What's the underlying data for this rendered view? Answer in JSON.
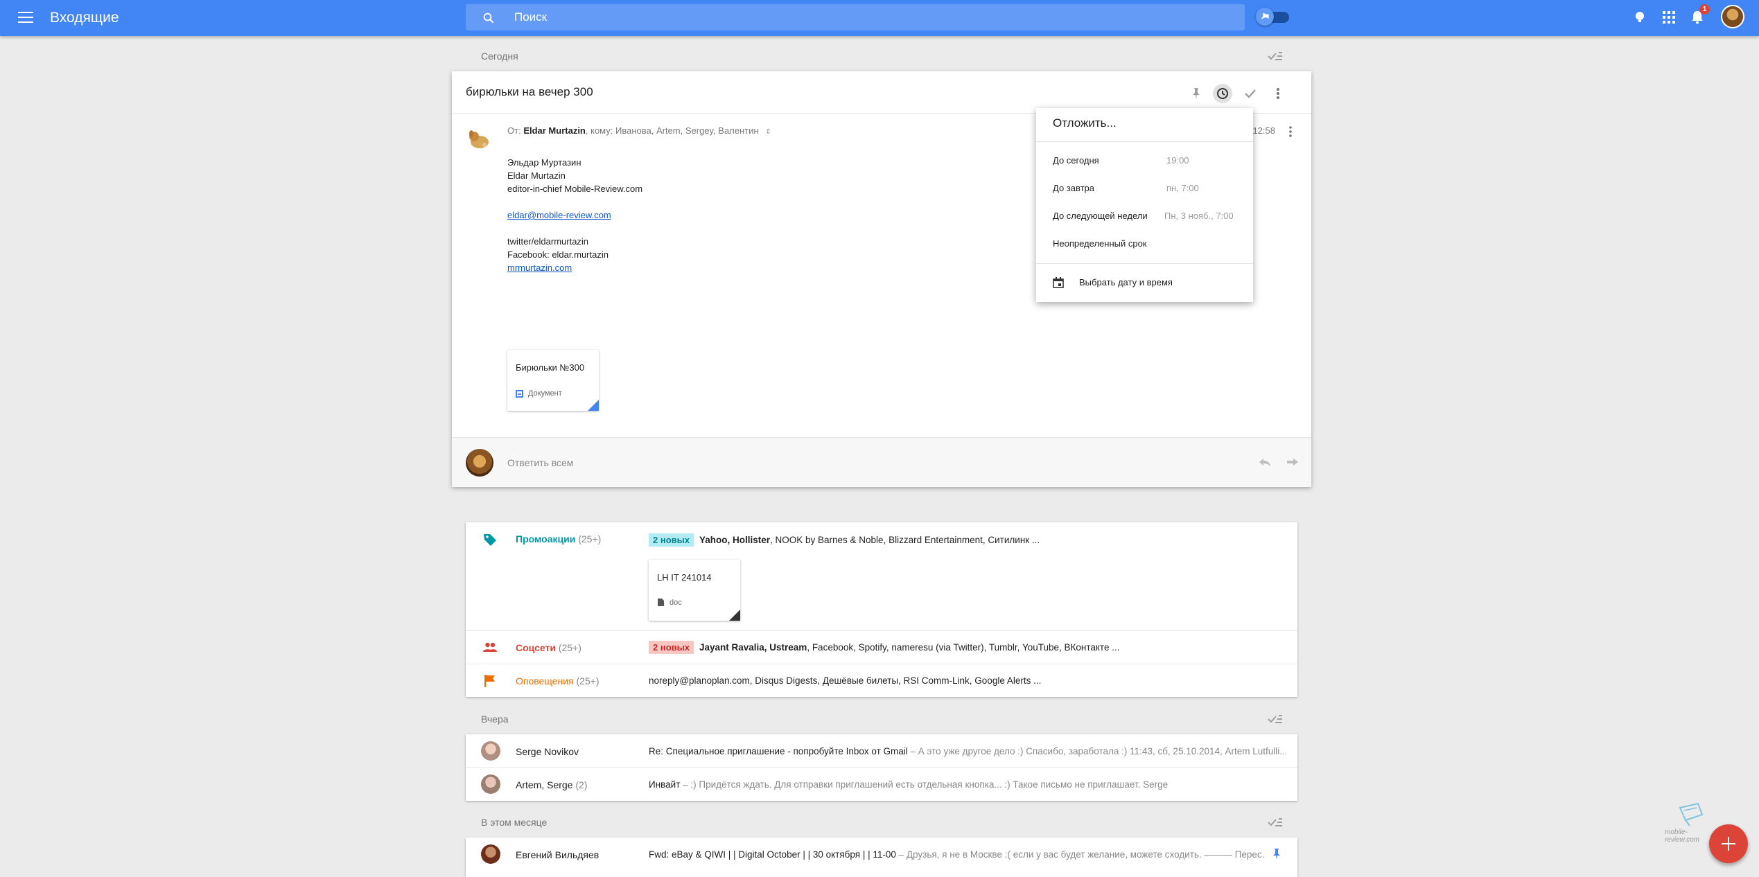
{
  "app": {
    "title": "Входящие"
  },
  "search": {
    "placeholder": "Поиск"
  },
  "notifications": {
    "count": "1"
  },
  "sections": {
    "today": "Сегодня",
    "yesterday": "Вчера",
    "this_month": "В этом месяце"
  },
  "thread": {
    "subject": "бирюльки на вечер 300",
    "from_prefix": "От:",
    "from_name": "Eldar Murtazin",
    "to_text": ", кому: Иванова, Artem, Sergey, Валентин",
    "time": "12:58",
    "body": {
      "line1": "Эльдар Муртазин",
      "line2": "Eldar Murtazin",
      "line3": "editor-in-chief Mobile-Review.com",
      "email_link": "eldar@mobile-review.com",
      "line5": "twitter/eldarmurtazin",
      "line6": "Facebook: eldar.murtazin",
      "site_link": "mrmurtazin.com"
    },
    "attachment": {
      "name": "Бирюльки №300",
      "type": "Документ"
    },
    "reply_placeholder": "Ответить всем"
  },
  "snooze_menu": {
    "title": "Отложить...",
    "options": [
      {
        "label": "До сегодня",
        "time": "19:00"
      },
      {
        "label": "До завтра",
        "time": "пн, 7:00"
      },
      {
        "label": "До следующей недели",
        "time": "Пн, 3 нояб., 7:00"
      },
      {
        "label": "Неопределенный срок",
        "time": ""
      }
    ],
    "pick_label": "Выбрать дату и время"
  },
  "bundles": [
    {
      "name": "Промоакции",
      "count": "(25+)",
      "new_badge": "2 новых",
      "senders_bold": "Yahoo, Hollister",
      "senders_rest": ", NOOK by Barnes & Noble, Blizzard Entertainment, Ситилинк ...",
      "attachment": {
        "name": "LH IT 241014",
        "type": "doc"
      },
      "color": "#0097a7"
    },
    {
      "name": "Соцсети",
      "count": "(25+)",
      "new_badge": "2 новых",
      "senders_bold": "Jayant Ravalia, Ustream",
      "senders_rest": ", Facebook, Spotify, nameresu (via Twitter), Tumblr, YouTube, ВКонтакте ...",
      "color": "#db4437"
    },
    {
      "name": "Оповещения",
      "count": "(25+)",
      "senders_rest": "noreply@planoplan.com, Disqus Digests, Дешёвые билеты, RSI Comm-Link, Google Alerts ...",
      "color": "#ef6c00"
    }
  ],
  "yesterday_items": [
    {
      "sender": "Serge Novikov",
      "count": "",
      "subject": "Re: Специальное приглашение - попробуйте Inbox от Gmail",
      "snippet": " – А это уже другое дело :) Спасибо, заработала :) 11:43, сб, 25.10.2014, Artem Lutfulli..."
    },
    {
      "sender": "Artem, Serge",
      "count": "(2)",
      "subject": "Инвайт",
      "snippet": " – :) Придётся ждать. Для отправки приглашений есть отдельная кнопка... :) Такое письмо не приглашает. Serge"
    }
  ],
  "month_items": [
    {
      "sender": "Евгений Вильдяев",
      "subject": "Fwd: eBay & QIWI | | Digital October | | 30 октября | | 11-00",
      "snippet": " – Друзья, я не в Москве :( если у вас будет желание, можете сходить. ——— Перес..."
    }
  ],
  "watermark": {
    "text": "mobile-review.com"
  },
  "colors": {
    "accent": "#4285f4",
    "fab": "#db4437",
    "link": "#1155cc"
  }
}
